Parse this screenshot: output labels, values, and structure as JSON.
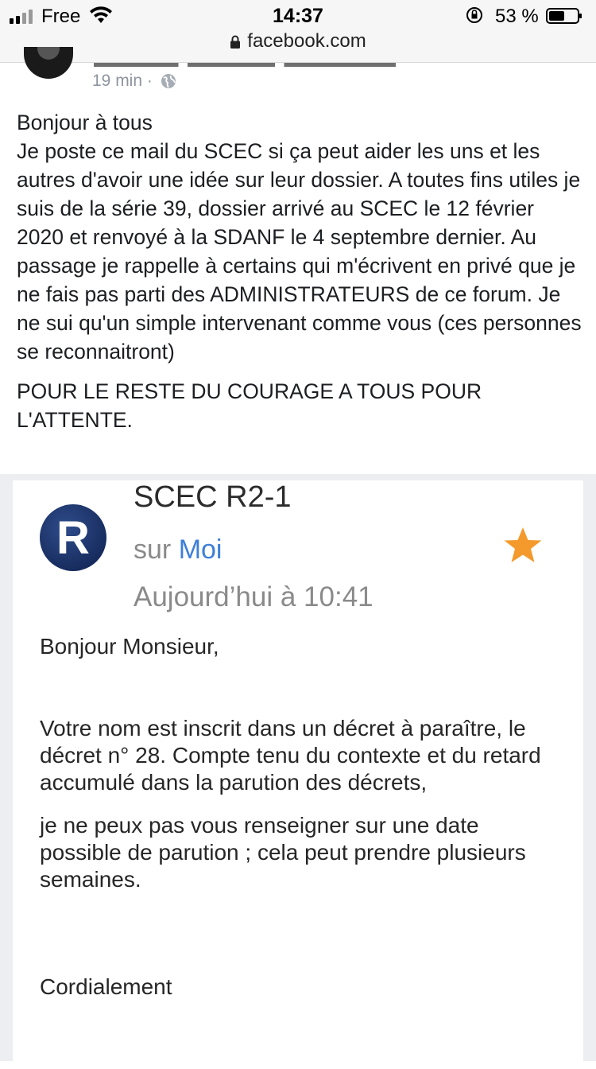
{
  "status": {
    "carrier": "Free",
    "time": "14:37",
    "battery": "53 %"
  },
  "browser": {
    "url": "facebook.com"
  },
  "post": {
    "time_ago": "19 min ·",
    "text_1": "Bonjour à tous\nJe poste ce mail du SCEC si ça peut aider les uns et les autres d'avoir une idée sur leur dossier. A toutes fins utiles je suis de la série 39, dossier arrivé au SCEC le 12 février 2020 et renvoyé à la SDANF le 4 septembre dernier. Au passage je rappelle à certains qui m'écrivent en privé que je ne fais pas parti des ADMINISTRATEURS de ce forum. Je ne sui qu'un simple intervenant comme vous (ces personnes se reconnaitront)",
    "text_2": "POUR LE RESTE DU COURAGE A TOUS POUR L'ATTENTE."
  },
  "email": {
    "logo_letter": "R",
    "sender": "SCEC R2-1",
    "to_prefix": "sur",
    "to_name": "Moi",
    "date": "Aujourd’hui à 10:41",
    "greeting": "Bonjour Monsieur,",
    "para_1": "Votre nom est inscrit dans un décret à paraître, le décret n° 28. Compte tenu du contexte et du retard accumulé dans la parution des décrets,",
    "para_2": "je ne peux pas vous renseigner sur une date possible de parution ; cela peut prendre plusieurs semaines.",
    "closing": "Cordialement"
  },
  "colors": {
    "link_blue": "#3d7fd8",
    "star_orange": "#f49a2c",
    "logo_navy": "#1f3769"
  }
}
